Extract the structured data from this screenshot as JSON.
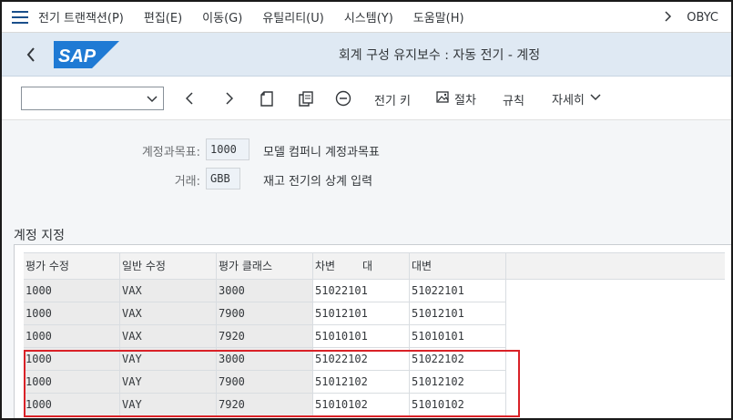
{
  "menubar": {
    "items": [
      "전기 트랜잭션(P)",
      "편집(E)",
      "이동(G)",
      "유틸리티(U)",
      "시스템(Y)",
      "도움말(H)"
    ],
    "system_id": "OBYC"
  },
  "header": {
    "title": "회계 구성 유지보수 : 자동 전기 - 계정",
    "logo_text": "SAP"
  },
  "toolbar": {
    "posting_key": "전기 키",
    "procedure": "절차",
    "rules": "규칙",
    "more": "자세히"
  },
  "form": {
    "coa_label": "계정과목표:",
    "coa_value": "1000",
    "coa_desc": "모델 컴퍼니 계정과목표",
    "txn_label": "거래:",
    "txn_value": "GBB",
    "txn_desc": "재고 전기의 상계 입력"
  },
  "section": {
    "title": "계정 지정"
  },
  "table": {
    "headers": [
      "평가 수정",
      "일반 수정",
      "평가 클래스",
      "차변",
      "대",
      "대변"
    ],
    "rows": [
      [
        "1000",
        "VAX",
        "3000",
        "51022101",
        "51022101"
      ],
      [
        "1000",
        "VAX",
        "7900",
        "51012101",
        "51012101"
      ],
      [
        "1000",
        "VAX",
        "7920",
        "51010101",
        "51010101"
      ],
      [
        "1000",
        "VAY",
        "3000",
        "51022102",
        "51022102"
      ],
      [
        "1000",
        "VAY",
        "7900",
        "51012102",
        "51012102"
      ],
      [
        "1000",
        "VAY",
        "7920",
        "51010102",
        "51010102"
      ]
    ]
  },
  "colors": {
    "highlight": "#d92127",
    "header_bg": "#dfe9f3",
    "logo_blue": "#1f7ad4"
  }
}
